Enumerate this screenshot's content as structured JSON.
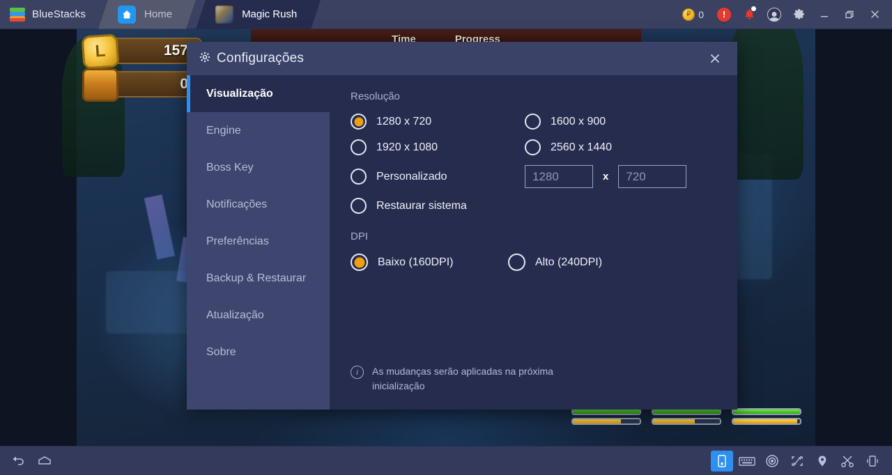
{
  "topbar": {
    "brand": "BlueStacks",
    "brand_logo_icon": "bluestacks-logo-icon",
    "tabs": [
      {
        "label": "Home",
        "icon": "home-icon",
        "active": false
      },
      {
        "label": "Magic Rush",
        "icon": "game-thumbnail-icon",
        "active": true
      }
    ],
    "coin_count": "0",
    "coin_icon": "coin-icon",
    "alert_icon": "alert-exclamation-icon",
    "notification_icon": "bell-icon",
    "account_icon": "account-avatar-icon",
    "settings_icon": "gear-icon",
    "minimize_icon": "minimize-icon",
    "restore_icon": "restore-icon",
    "close_icon": "close-icon"
  },
  "game": {
    "banner": {
      "time_label": "Time",
      "progress_label": "Progress"
    },
    "hud": [
      {
        "icon": "gold-coin-badge-icon",
        "badge_glyph": "L",
        "value": "157"
      },
      {
        "icon": "treasure-chest-icon",
        "badge_glyph": "",
        "value": "0"
      }
    ],
    "bars": [
      {
        "hp_percent": 100,
        "energy_percent": 72
      },
      {
        "hp_percent": 100,
        "energy_percent": 62
      },
      {
        "hp_percent": 100,
        "energy_percent": 96
      }
    ]
  },
  "dialog": {
    "title": "Configurações",
    "gear_icon": "gear-icon",
    "close_icon": "close-icon",
    "sidebar": [
      {
        "label": "Visualização",
        "active": true
      },
      {
        "label": "Engine",
        "active": false
      },
      {
        "label": "Boss Key",
        "active": false
      },
      {
        "label": "Notificações",
        "active": false
      },
      {
        "label": "Preferências",
        "active": false
      },
      {
        "label": "Backup & Restaurar",
        "active": false
      },
      {
        "label": "Atualização",
        "active": false
      },
      {
        "label": "Sobre",
        "active": false
      }
    ],
    "resolution": {
      "section_title": "Resolução",
      "options": [
        {
          "label": "1280 x 720",
          "selected": true
        },
        {
          "label": "1600 x 900",
          "selected": false
        },
        {
          "label": "1920 x 1080",
          "selected": false
        },
        {
          "label": "2560 x 1440",
          "selected": false
        }
      ],
      "custom": {
        "label": "Personalizado",
        "selected": false,
        "width_value": "",
        "width_placeholder": "1280",
        "separator": "x",
        "height_value": "",
        "height_placeholder": "720"
      },
      "restore": {
        "label": "Restaurar sistema",
        "selected": false
      }
    },
    "dpi": {
      "section_title": "DPI",
      "options": [
        {
          "label": "Baixo (160DPI)",
          "selected": true
        },
        {
          "label": "Alto (240DPI)",
          "selected": false
        }
      ]
    },
    "note": {
      "icon": "info-icon",
      "text": "As mudanças serão aplicadas na próxima inicialização"
    }
  },
  "bottombar": {
    "left": [
      {
        "icon": "back-arrow-icon"
      },
      {
        "icon": "home-outline-icon"
      }
    ],
    "right": [
      {
        "icon": "device-phone-icon",
        "selected": true
      },
      {
        "icon": "keyboard-icon",
        "selected": false
      },
      {
        "icon": "eye-target-icon",
        "selected": false
      },
      {
        "icon": "fullscreen-icon",
        "selected": false
      },
      {
        "icon": "location-pin-icon",
        "selected": false
      },
      {
        "icon": "scissors-icon",
        "selected": false
      },
      {
        "icon": "shake-device-icon",
        "selected": false
      }
    ]
  },
  "colors": {
    "accent_blue": "#2d8ff0",
    "radio_orange": "#f2a007",
    "dialog_bg": "#262c4e",
    "sidebar_bg": "#3e4670",
    "header_bg": "#3b4268"
  }
}
